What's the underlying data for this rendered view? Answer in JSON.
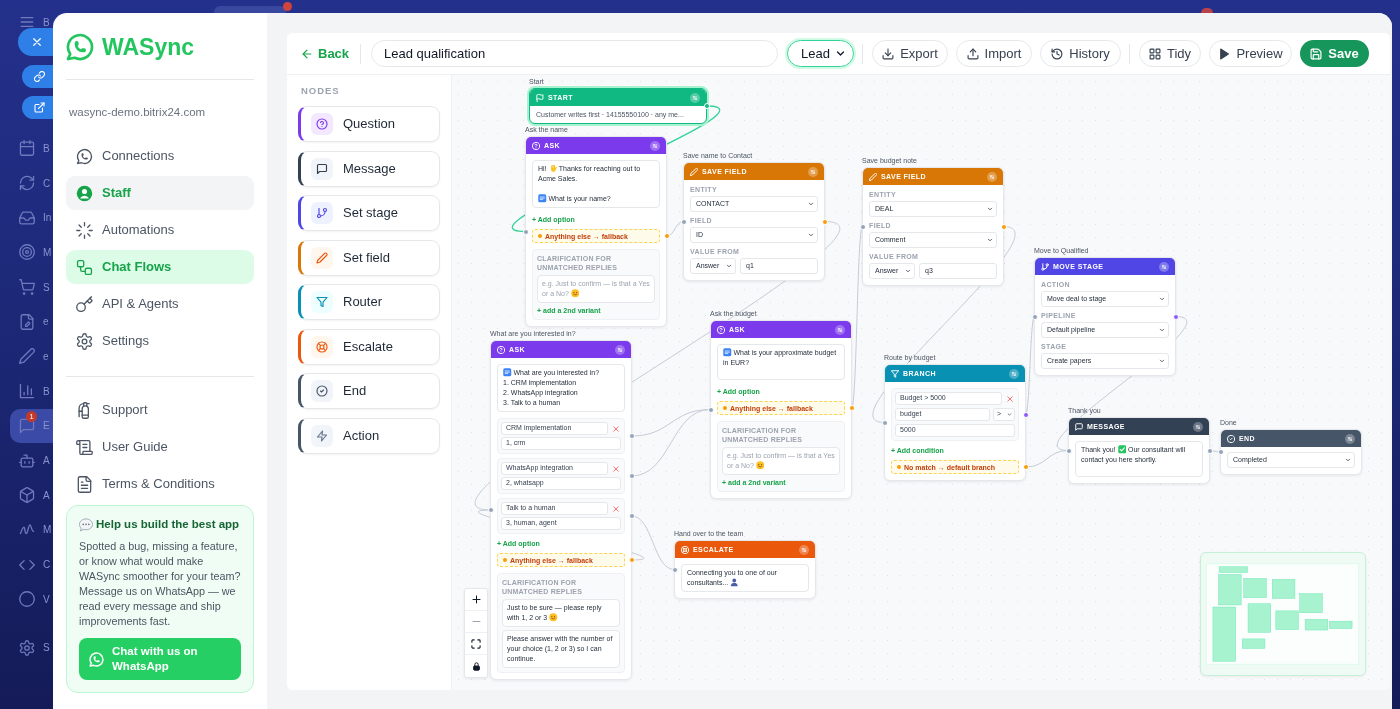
{
  "host_app": {
    "menu": [
      {
        "kind": "menu",
        "text": "B",
        "selected": false
      },
      {
        "kind": "calendar",
        "text": "B",
        "selected": false
      },
      {
        "kind": "cycle",
        "text": "C",
        "selected": false
      },
      {
        "kind": "inbox",
        "text": "In",
        "selected": false
      },
      {
        "kind": "target",
        "text": "M",
        "selected": false
      },
      {
        "kind": "cart",
        "text": "S",
        "selected": false
      },
      {
        "kind": "file",
        "text": "e",
        "selected": false
      },
      {
        "kind": "pencil",
        "text": "e",
        "selected": false
      },
      {
        "kind": "chart",
        "text": "B",
        "selected": false
      },
      {
        "kind": "chat",
        "text": "E",
        "selected": true,
        "badge": "1"
      },
      {
        "kind": "bot",
        "text": "A",
        "selected": false
      },
      {
        "kind": "box",
        "text": "A",
        "selected": false
      },
      {
        "kind": "script",
        "text": "M",
        "selected": false
      },
      {
        "kind": "code",
        "text": "C",
        "selected": false
      },
      {
        "kind": "circle",
        "text": "V",
        "selected": false
      },
      {
        "kind": "gear",
        "text": "S",
        "selected": false
      }
    ]
  },
  "sidebar": {
    "brand": "WASync",
    "portal": "wasync-demo.bitrix24.com",
    "nav": [
      {
        "label": "Connections",
        "kind": "whatsapp",
        "selected": false,
        "hovered": false
      },
      {
        "label": "Staff",
        "kind": "staff",
        "selected": false,
        "hovered": true
      },
      {
        "label": "Automations",
        "kind": "automations",
        "selected": false,
        "hovered": false
      },
      {
        "label": "Chat Flows",
        "kind": "flows",
        "selected": true,
        "hovered": false
      },
      {
        "label": "API & Agents",
        "kind": "key",
        "selected": false,
        "hovered": false
      },
      {
        "label": "Settings",
        "kind": "settings",
        "selected": false,
        "hovered": false
      }
    ],
    "links": [
      {
        "label": "Support",
        "kind": "support"
      },
      {
        "label": "User Guide",
        "kind": "guide"
      },
      {
        "label": "Terms & Conditions",
        "kind": "terms"
      }
    ],
    "feedback": {
      "title": "Help us build the best app",
      "text": "Spotted a bug, missing a feature, or know what would make WASync smoother for your team? Message us on WhatsApp — we read every message and ship improvements fast.",
      "button": "Chat with us on WhatsApp"
    }
  },
  "toolbar": {
    "back": "Back",
    "flow_name": "Lead qualification",
    "category": "Lead",
    "actions": [
      {
        "label": "Export",
        "kind": "export"
      },
      {
        "label": "Import",
        "kind": "import"
      },
      {
        "label": "History",
        "kind": "history"
      }
    ],
    "view_actions": [
      {
        "label": "Tidy",
        "kind": "tidy"
      },
      {
        "label": "Preview",
        "kind": "preview"
      }
    ],
    "save": "Save"
  },
  "palette": {
    "title": "NODES",
    "items": [
      {
        "label": "Question",
        "kind": "question"
      },
      {
        "label": "Message",
        "kind": "message"
      },
      {
        "label": "Set stage",
        "kind": "set_stage"
      },
      {
        "label": "Set field",
        "kind": "set_field"
      },
      {
        "label": "Router",
        "kind": "router"
      },
      {
        "label": "Escalate",
        "kind": "escalate"
      },
      {
        "label": "End",
        "kind": "end"
      },
      {
        "label": "Action",
        "kind": "action"
      }
    ]
  },
  "canvas": {
    "nodes": [
      {
        "kind": "start",
        "label": "Start",
        "title": "START",
        "selected": true,
        "summary": "Customer writes first · 14155550100 · any me..."
      },
      {
        "kind": "ask",
        "label": "Ask the name",
        "title": "ASK",
        "selected": false,
        "message": [
          {
            "kind": "text",
            "text": "Hi! "
          },
          {
            "kind": "wave"
          },
          {
            "kind": "text",
            "text": " Thanks for reaching out to Acme Sales."
          },
          {
            "kind": "break"
          },
          {
            "kind": "keycap"
          },
          {
            "kind": "text",
            "text": " What is your name?"
          }
        ],
        "add_option": "+ Add option",
        "fallback": "Anything else → fallback",
        "clarification": {
          "title": "CLARIFICATION FOR UNMATCHED REPLIES",
          "variants": [
            {
              "placeholder": [
                {
                  "kind": "text",
                  "text": "e.g. Just to confirm — is that a Yes or a No? "
                },
                {
                  "kind": "smile"
                }
              ]
            }
          ],
          "add_variant": "+ add a 2nd variant"
        }
      },
      {
        "kind": "save_field",
        "label": "Save name to Contact",
        "title": "SAVE FIELD",
        "selected": false,
        "fields": [
          {
            "kind": "select",
            "label": "ENTITY",
            "value": "CONTACT"
          },
          {
            "kind": "select",
            "label": "FIELD",
            "value": "ID"
          },
          {
            "kind": "source",
            "label": "VALUE FROM",
            "value": "Answer",
            "input": "q1"
          }
        ]
      },
      {
        "kind": "save_field",
        "label": "Save budget note",
        "title": "SAVE FIELD",
        "selected": false,
        "fields": [
          {
            "kind": "select",
            "label": "ENTITY",
            "value": "DEAL"
          },
          {
            "kind": "select",
            "label": "FIELD",
            "value": "Comment"
          },
          {
            "kind": "source",
            "label": "VALUE FROM",
            "value": "Answer",
            "input": "q3"
          }
        ]
      },
      {
        "kind": "ask",
        "label": "Ask the budget",
        "title": "ASK",
        "selected": false,
        "message": [
          {
            "kind": "keycap"
          },
          {
            "kind": "text",
            "text": " What is your approximate budget in EUR?"
          }
        ],
        "add_option": "+ Add option",
        "fallback": "Anything else → fallback",
        "clarification": {
          "title": "CLARIFICATION FOR UNMATCHED REPLIES",
          "variants": [
            {
              "placeholder": [
                {
                  "kind": "text",
                  "text": "e.g. Just to confirm — is that a Yes or a No? "
                },
                {
                  "kind": "smile"
                }
              ]
            }
          ],
          "add_variant": "+ add a 2nd variant"
        }
      },
      {
        "kind": "ask",
        "label": "What are you interested in?",
        "title": "ASK",
        "selected": false,
        "message": [
          {
            "kind": "keycap"
          },
          {
            "kind": "text",
            "text": " What are you interested in?\n1. CRM implementation\n2. WhatsApp integration\n3. Talk to a human"
          }
        ],
        "options": [
          {
            "label": "CRM implementation",
            "keywords": "1, crm"
          },
          {
            "label": "WhatsApp integration",
            "keywords": "2, whatsapp"
          },
          {
            "label": "Talk to a human",
            "keywords": "3, human, agent"
          }
        ],
        "add_option": "+ Add option",
        "fallback": "Anything else → fallback",
        "clarification": {
          "title": "CLARIFICATION FOR UNMATCHED REPLIES",
          "variants": [
            {
              "value": [
                {
                  "kind": "text",
                  "text": "Just to be sure — please reply with 1, 2 or 3 "
                },
                {
                  "kind": "smile"
                }
              ]
            },
            {
              "value": [
                {
                  "kind": "text",
                  "text": "Please answer with the number of your choice (1, 2 or 3) so I can continue."
                }
              ]
            }
          ]
        }
      },
      {
        "kind": "escalate",
        "label": "Hand over to the team",
        "title": "ESCALATE",
        "selected": false,
        "message": [
          {
            "kind": "text",
            "text": "Connecting you to one of our consultants... "
          },
          {
            "kind": "person"
          }
        ]
      },
      {
        "kind": "branch",
        "label": "Route by budget",
        "title": "BRANCH",
        "selected": false,
        "conditions": [
          {
            "name": "Budget > 5000",
            "variable": "budget",
            "operator": ">",
            "value": "5000"
          }
        ],
        "add_condition": "+ Add condition",
        "fallback": "No match → default branch"
      },
      {
        "kind": "move_stage",
        "label": "Move to Qualified",
        "title": "MOVE STAGE",
        "selected": false,
        "fields": [
          {
            "kind": "select",
            "label": "ACTION",
            "value": "Move deal to stage"
          },
          {
            "kind": "select",
            "label": "PIPELINE",
            "value": "Default pipeline"
          },
          {
            "kind": "select",
            "label": "STAGE",
            "value": "Create papers"
          }
        ]
      },
      {
        "kind": "message",
        "label": "Thank you",
        "title": "MESSAGE",
        "selected": false,
        "message": [
          {
            "kind": "text",
            "text": "Thank you! "
          },
          {
            "kind": "check"
          },
          {
            "kind": "text",
            "text": " Our consultant will contact you here shortly."
          }
        ]
      },
      {
        "kind": "end",
        "label": "Done",
        "title": "END",
        "selected": false,
        "fields": [
          {
            "kind": "select",
            "value": "Completed"
          }
        ]
      }
    ]
  }
}
